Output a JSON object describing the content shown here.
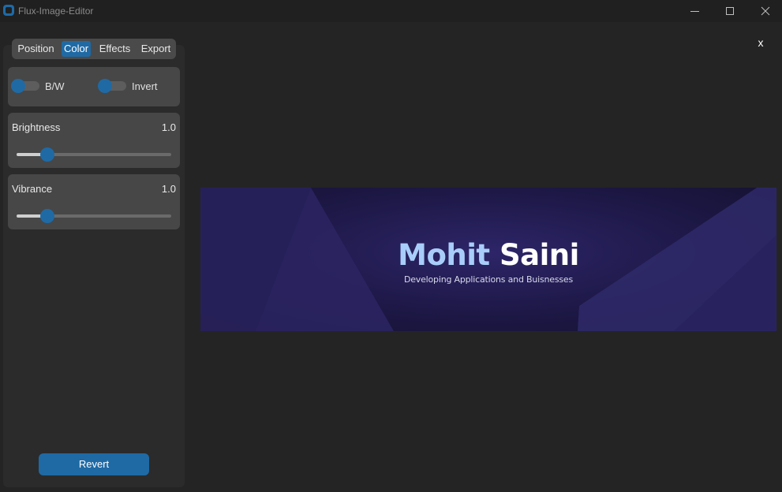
{
  "window": {
    "title": "Flux-Image-Editor",
    "controls": [
      "minimize-icon",
      "maximize-icon",
      "close-icon"
    ]
  },
  "sidebar": {
    "tabs": [
      {
        "label": "Position",
        "active": false
      },
      {
        "label": "Color",
        "active": true
      },
      {
        "label": "Effects",
        "active": false
      },
      {
        "label": "Export",
        "active": false
      }
    ],
    "toggles": {
      "bw": {
        "label": "B/W",
        "on": false
      },
      "invert": {
        "label": "Invert",
        "on": false
      }
    },
    "brightness": {
      "label": "Brightness",
      "value": "1.0",
      "fraction": 0.2
    },
    "vibrance": {
      "label": "Vibrance",
      "value": "1.0",
      "fraction": 0.2
    },
    "revert_label": "Revert"
  },
  "image_area": {
    "close_label": "x",
    "banner": {
      "first_name": "Mohit",
      "last_name": "Saini",
      "tagline": "Developing Applications and Buisnesses"
    }
  },
  "colors": {
    "accent": "#1f6aa5",
    "background": "#242424",
    "sidebar": "#2b2b2b",
    "panel": "#474747"
  }
}
